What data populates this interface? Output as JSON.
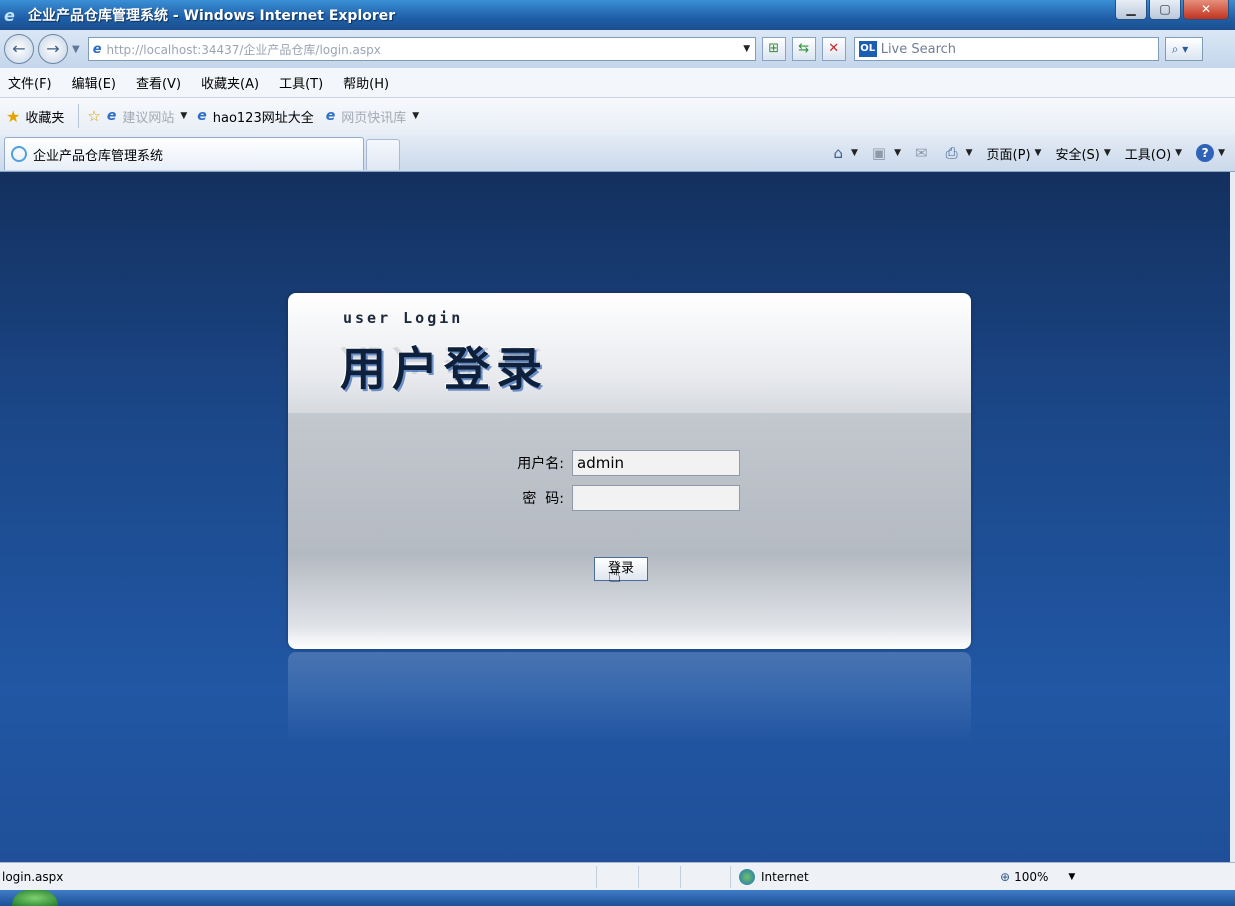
{
  "window": {
    "title": "企业产品仓库管理系统 - Windows Internet Explorer",
    "buttons": {
      "minimize": "▁",
      "restore": "▢",
      "close": "✕"
    }
  },
  "addressbar": {
    "url": "http://localhost:34437/企业产品仓库/login.aspx",
    "search_placeholder": "Live Search"
  },
  "menu": {
    "items": [
      "文件(F)",
      "编辑(E)",
      "查看(V)",
      "收藏夹(A)",
      "工具(T)",
      "帮助(H)"
    ]
  },
  "favorites": {
    "label": "收藏夹",
    "links": [
      {
        "label": "建议网站",
        "dimmed": true
      },
      {
        "label": "hao123网址大全",
        "dimmed": false
      },
      {
        "label": "网页快讯库",
        "dimmed": true
      }
    ]
  },
  "tabs": {
    "active": "企业产品仓库管理系统"
  },
  "commandbar": {
    "page": "页面(P)",
    "safety": "安全(S)",
    "tools": "工具(O)"
  },
  "login": {
    "subtitle": "user Login",
    "title": "用户登录",
    "username_label": "用户名:",
    "username_value": "admin",
    "password_label": "密  码:",
    "password_value": "",
    "submit_label": "登录"
  },
  "status": {
    "text": "login.aspx",
    "zone": "Internet",
    "zoom": "100%"
  }
}
